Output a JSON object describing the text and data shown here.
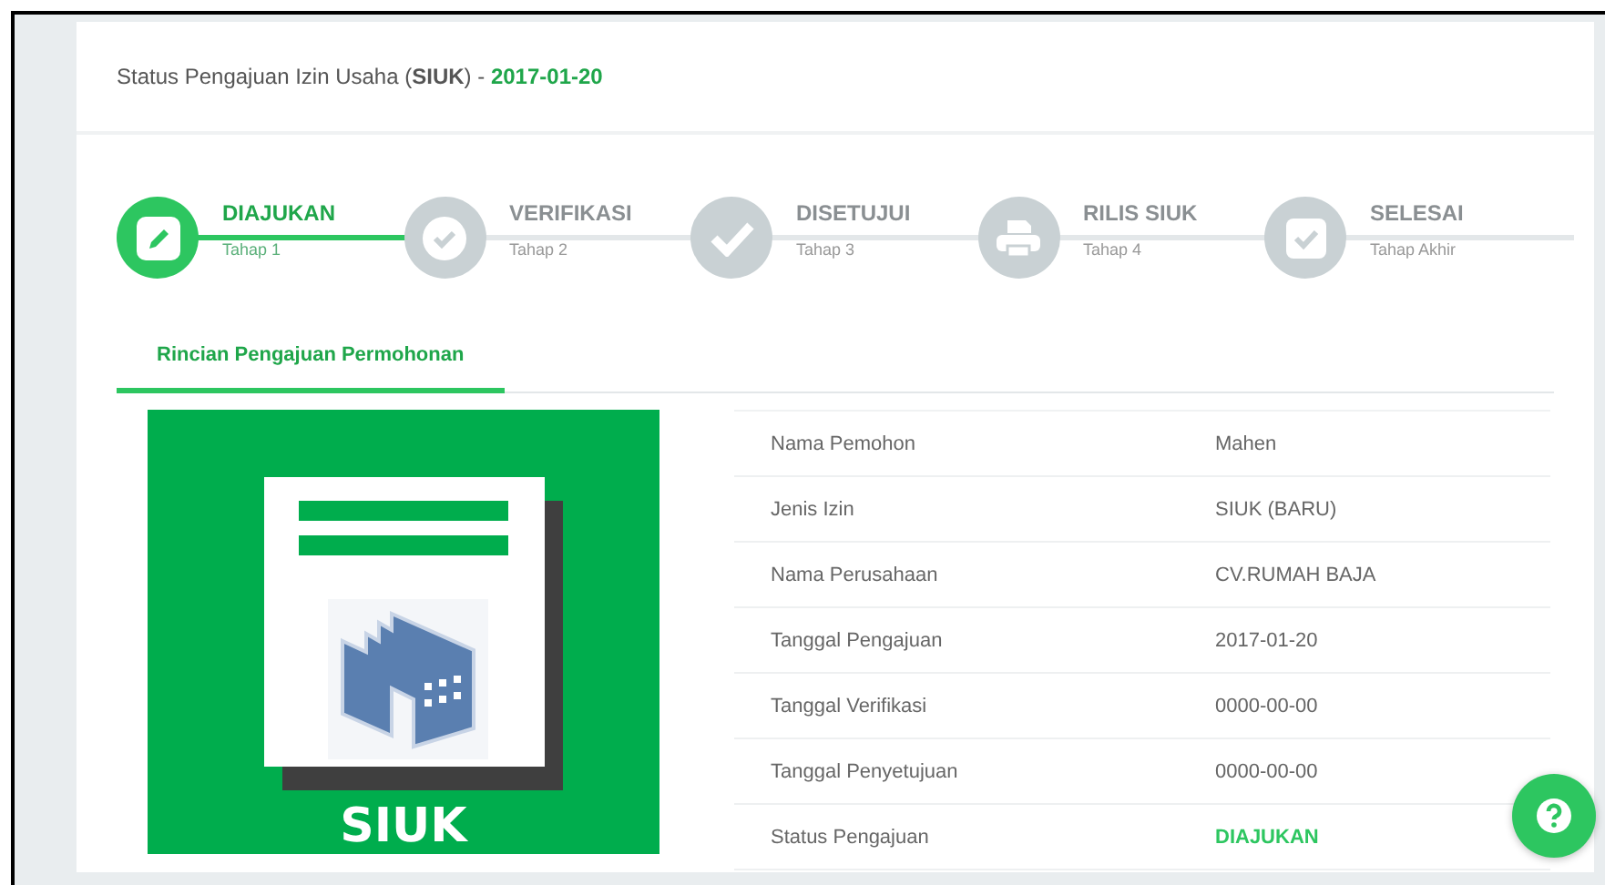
{
  "header": {
    "title": "Status Pengajuan Izin Usaha (**SIUK**) - ",
    "date": "2017-01-20"
  },
  "steps": [
    {
      "label": "DIAJUKAN",
      "sub": "Tahap 1",
      "kind": "pencil",
      "active": true
    },
    {
      "label": "VERIFIKASI",
      "sub": "Tahap 2",
      "kind": "check-circle",
      "active": false
    },
    {
      "label": "DISETUJUI",
      "sub": "Tahap 3",
      "kind": "check",
      "active": false
    },
    {
      "label": "RILIS SIUK",
      "sub": "Tahap 4",
      "kind": "printer",
      "active": false
    },
    {
      "label": "SELESAI",
      "sub": "Tahap Akhir",
      "kind": "checkbox",
      "active": false
    }
  ],
  "tabs": [
    {
      "label": "Rincian Pengajuan Permohonan",
      "selected": true
    }
  ],
  "permit_card": {
    "title": "SIUK"
  },
  "details": [
    {
      "label": "Nama Pemohon",
      "value": "Mahen",
      "kind": "text"
    },
    {
      "label": "Jenis Izin",
      "value": "SIUK (BARU)",
      "kind": "text"
    },
    {
      "label": "Nama Perusahaan",
      "value": "CV.RUMAH BAJA",
      "kind": "text"
    },
    {
      "label": "Tanggal Pengajuan",
      "value": "2017-01-20",
      "kind": "text"
    },
    {
      "label": "Tanggal Verifikasi",
      "value": "0000-00-00",
      "kind": "text"
    },
    {
      "label": "Tanggal Penyetujuan",
      "value": "0000-00-00",
      "kind": "text"
    },
    {
      "label": "Status Pengajuan",
      "value": "DIAJUKAN",
      "kind": "status"
    }
  ]
}
